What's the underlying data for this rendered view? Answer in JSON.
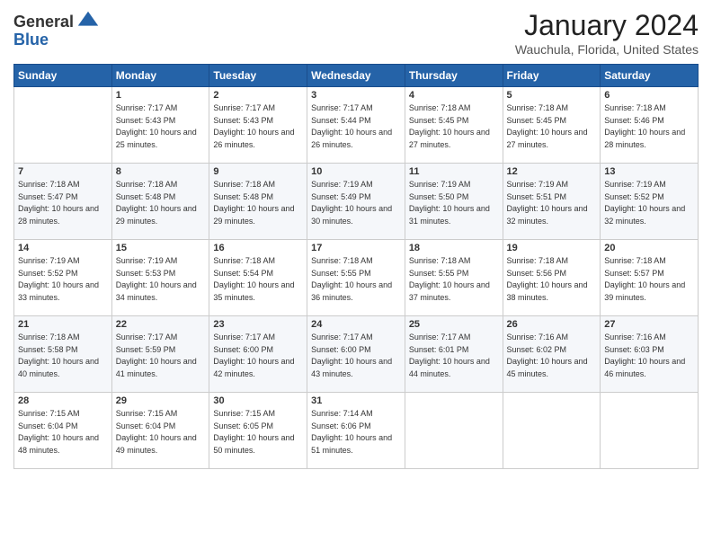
{
  "header": {
    "logo_line1": "General",
    "logo_line2": "Blue",
    "month": "January 2024",
    "location": "Wauchula, Florida, United States"
  },
  "weekdays": [
    "Sunday",
    "Monday",
    "Tuesday",
    "Wednesday",
    "Thursday",
    "Friday",
    "Saturday"
  ],
  "weeks": [
    [
      {
        "day": "",
        "sunrise": "",
        "sunset": "",
        "daylight": ""
      },
      {
        "day": "1",
        "sunrise": "Sunrise: 7:17 AM",
        "sunset": "Sunset: 5:43 PM",
        "daylight": "Daylight: 10 hours and 25 minutes."
      },
      {
        "day": "2",
        "sunrise": "Sunrise: 7:17 AM",
        "sunset": "Sunset: 5:43 PM",
        "daylight": "Daylight: 10 hours and 26 minutes."
      },
      {
        "day": "3",
        "sunrise": "Sunrise: 7:17 AM",
        "sunset": "Sunset: 5:44 PM",
        "daylight": "Daylight: 10 hours and 26 minutes."
      },
      {
        "day": "4",
        "sunrise": "Sunrise: 7:18 AM",
        "sunset": "Sunset: 5:45 PM",
        "daylight": "Daylight: 10 hours and 27 minutes."
      },
      {
        "day": "5",
        "sunrise": "Sunrise: 7:18 AM",
        "sunset": "Sunset: 5:45 PM",
        "daylight": "Daylight: 10 hours and 27 minutes."
      },
      {
        "day": "6",
        "sunrise": "Sunrise: 7:18 AM",
        "sunset": "Sunset: 5:46 PM",
        "daylight": "Daylight: 10 hours and 28 minutes."
      }
    ],
    [
      {
        "day": "7",
        "sunrise": "Sunrise: 7:18 AM",
        "sunset": "Sunset: 5:47 PM",
        "daylight": "Daylight: 10 hours and 28 minutes."
      },
      {
        "day": "8",
        "sunrise": "Sunrise: 7:18 AM",
        "sunset": "Sunset: 5:48 PM",
        "daylight": "Daylight: 10 hours and 29 minutes."
      },
      {
        "day": "9",
        "sunrise": "Sunrise: 7:18 AM",
        "sunset": "Sunset: 5:48 PM",
        "daylight": "Daylight: 10 hours and 29 minutes."
      },
      {
        "day": "10",
        "sunrise": "Sunrise: 7:19 AM",
        "sunset": "Sunset: 5:49 PM",
        "daylight": "Daylight: 10 hours and 30 minutes."
      },
      {
        "day": "11",
        "sunrise": "Sunrise: 7:19 AM",
        "sunset": "Sunset: 5:50 PM",
        "daylight": "Daylight: 10 hours and 31 minutes."
      },
      {
        "day": "12",
        "sunrise": "Sunrise: 7:19 AM",
        "sunset": "Sunset: 5:51 PM",
        "daylight": "Daylight: 10 hours and 32 minutes."
      },
      {
        "day": "13",
        "sunrise": "Sunrise: 7:19 AM",
        "sunset": "Sunset: 5:52 PM",
        "daylight": "Daylight: 10 hours and 32 minutes."
      }
    ],
    [
      {
        "day": "14",
        "sunrise": "Sunrise: 7:19 AM",
        "sunset": "Sunset: 5:52 PM",
        "daylight": "Daylight: 10 hours and 33 minutes."
      },
      {
        "day": "15",
        "sunrise": "Sunrise: 7:19 AM",
        "sunset": "Sunset: 5:53 PM",
        "daylight": "Daylight: 10 hours and 34 minutes."
      },
      {
        "day": "16",
        "sunrise": "Sunrise: 7:18 AM",
        "sunset": "Sunset: 5:54 PM",
        "daylight": "Daylight: 10 hours and 35 minutes."
      },
      {
        "day": "17",
        "sunrise": "Sunrise: 7:18 AM",
        "sunset": "Sunset: 5:55 PM",
        "daylight": "Daylight: 10 hours and 36 minutes."
      },
      {
        "day": "18",
        "sunrise": "Sunrise: 7:18 AM",
        "sunset": "Sunset: 5:55 PM",
        "daylight": "Daylight: 10 hours and 37 minutes."
      },
      {
        "day": "19",
        "sunrise": "Sunrise: 7:18 AM",
        "sunset": "Sunset: 5:56 PM",
        "daylight": "Daylight: 10 hours and 38 minutes."
      },
      {
        "day": "20",
        "sunrise": "Sunrise: 7:18 AM",
        "sunset": "Sunset: 5:57 PM",
        "daylight": "Daylight: 10 hours and 39 minutes."
      }
    ],
    [
      {
        "day": "21",
        "sunrise": "Sunrise: 7:18 AM",
        "sunset": "Sunset: 5:58 PM",
        "daylight": "Daylight: 10 hours and 40 minutes."
      },
      {
        "day": "22",
        "sunrise": "Sunrise: 7:17 AM",
        "sunset": "Sunset: 5:59 PM",
        "daylight": "Daylight: 10 hours and 41 minutes."
      },
      {
        "day": "23",
        "sunrise": "Sunrise: 7:17 AM",
        "sunset": "Sunset: 6:00 PM",
        "daylight": "Daylight: 10 hours and 42 minutes."
      },
      {
        "day": "24",
        "sunrise": "Sunrise: 7:17 AM",
        "sunset": "Sunset: 6:00 PM",
        "daylight": "Daylight: 10 hours and 43 minutes."
      },
      {
        "day": "25",
        "sunrise": "Sunrise: 7:17 AM",
        "sunset": "Sunset: 6:01 PM",
        "daylight": "Daylight: 10 hours and 44 minutes."
      },
      {
        "day": "26",
        "sunrise": "Sunrise: 7:16 AM",
        "sunset": "Sunset: 6:02 PM",
        "daylight": "Daylight: 10 hours and 45 minutes."
      },
      {
        "day": "27",
        "sunrise": "Sunrise: 7:16 AM",
        "sunset": "Sunset: 6:03 PM",
        "daylight": "Daylight: 10 hours and 46 minutes."
      }
    ],
    [
      {
        "day": "28",
        "sunrise": "Sunrise: 7:15 AM",
        "sunset": "Sunset: 6:04 PM",
        "daylight": "Daylight: 10 hours and 48 minutes."
      },
      {
        "day": "29",
        "sunrise": "Sunrise: 7:15 AM",
        "sunset": "Sunset: 6:04 PM",
        "daylight": "Daylight: 10 hours and 49 minutes."
      },
      {
        "day": "30",
        "sunrise": "Sunrise: 7:15 AM",
        "sunset": "Sunset: 6:05 PM",
        "daylight": "Daylight: 10 hours and 50 minutes."
      },
      {
        "day": "31",
        "sunrise": "Sunrise: 7:14 AM",
        "sunset": "Sunset: 6:06 PM",
        "daylight": "Daylight: 10 hours and 51 minutes."
      },
      {
        "day": "",
        "sunrise": "",
        "sunset": "",
        "daylight": ""
      },
      {
        "day": "",
        "sunrise": "",
        "sunset": "",
        "daylight": ""
      },
      {
        "day": "",
        "sunrise": "",
        "sunset": "",
        "daylight": ""
      }
    ]
  ]
}
